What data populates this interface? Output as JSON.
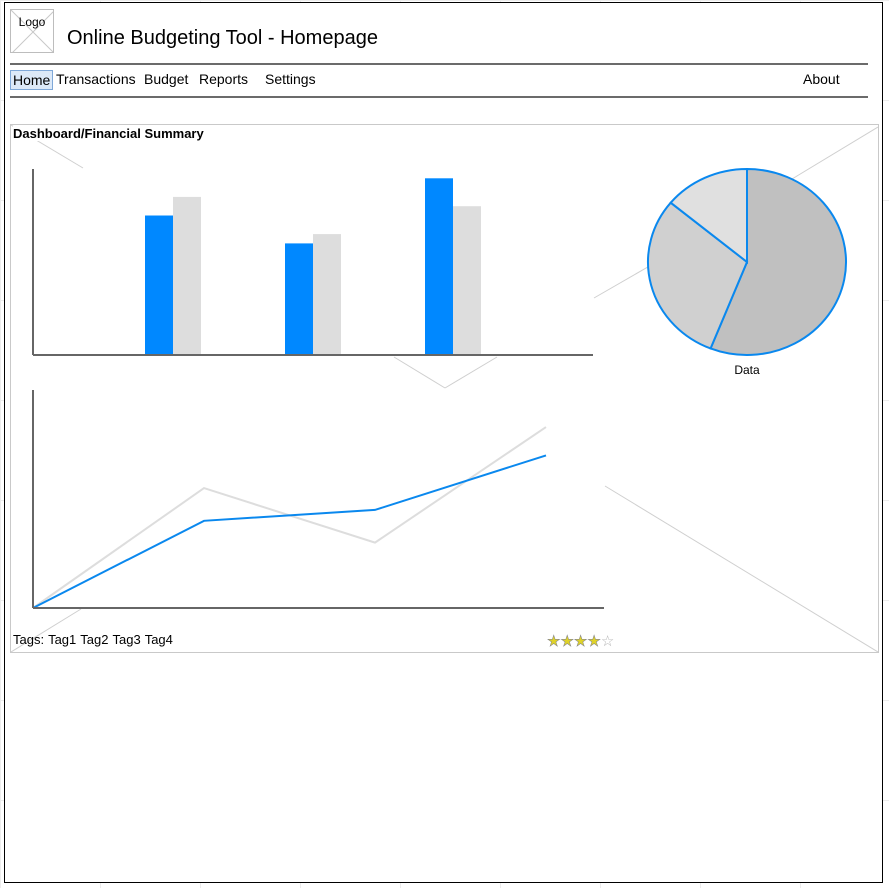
{
  "header": {
    "logo_text": "Logo",
    "title": "Online Budgeting Tool - Homepage"
  },
  "nav": {
    "items": [
      {
        "label": "Home",
        "active": true
      },
      {
        "label": "Transactions"
      },
      {
        "label": "Budget"
      },
      {
        "label": "Reports"
      },
      {
        "label": "Settings"
      }
    ],
    "about_label": "About"
  },
  "dashboard": {
    "title": "Dashboard/Financial Summary",
    "tags_label": "Tags:",
    "tags": [
      "Tag1",
      "Tag2",
      "Tag3",
      "Tag4"
    ],
    "rating": {
      "value": 4,
      "max": 5
    }
  },
  "colors": {
    "accent": "#0a88ee",
    "bar_primary": "#0088ff",
    "bar_secondary": "#dddddd",
    "pie_dark": "#c0c0c0",
    "pie_mid": "#d0d0d0",
    "pie_light": "#e0e0e0",
    "axis": "#666666"
  },
  "chart_data": [
    {
      "type": "bar",
      "categories": [
        "",
        "",
        ""
      ],
      "series": [
        {
          "values": [
            75,
            60,
            95
          ]
        },
        {
          "values": [
            85,
            65,
            80
          ]
        }
      ],
      "ylim": [
        0,
        100
      ],
      "grid": false
    },
    {
      "type": "pie",
      "labels": [
        "",
        "",
        ""
      ],
      "values": [
        56,
        30,
        14
      ],
      "xlabel": "Data"
    },
    {
      "type": "line",
      "x": [
        0,
        1,
        2,
        3
      ],
      "series": [
        {
          "values": [
            0,
            40,
            45,
            70
          ]
        },
        {
          "values": [
            0,
            55,
            30,
            83
          ]
        }
      ],
      "ylim": [
        0,
        100
      ],
      "grid": false
    }
  ]
}
